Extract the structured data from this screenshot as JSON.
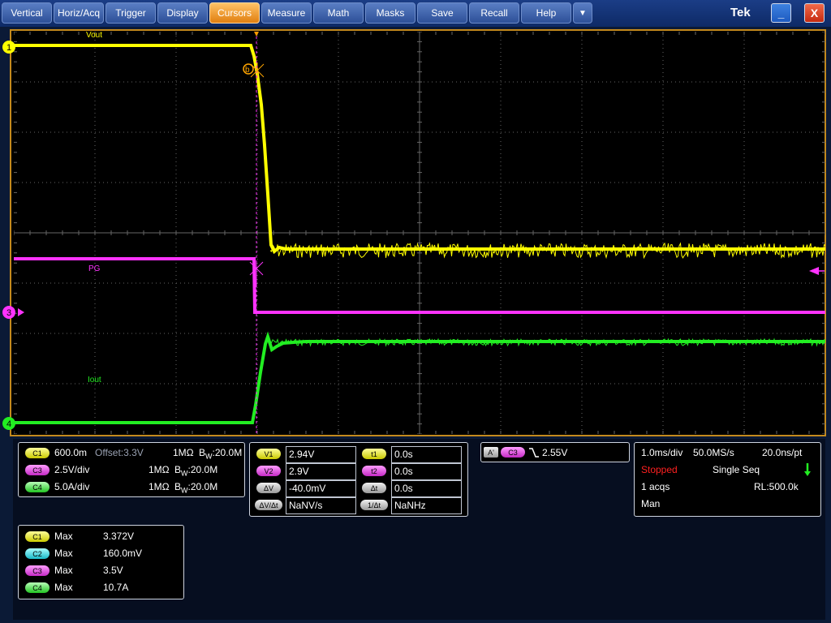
{
  "menu": {
    "items": [
      "Vertical",
      "Horiz/Acq",
      "Trigger",
      "Display",
      "Cursors",
      "Measure",
      "Math",
      "Masks",
      "Save",
      "Recall",
      "Help"
    ],
    "active": "Cursors",
    "more": "▼",
    "brand": "Tek",
    "minimize": "_",
    "close": "X"
  },
  "waveform": {
    "labels": {
      "vout": "Vout",
      "pg": "PG",
      "iout": "Iout"
    },
    "markers": {
      "ch1": "1",
      "ch3": "3",
      "ch4": "4",
      "cursor_b": "b"
    },
    "colors": {
      "ch1": "#ffff00",
      "ch3": "#ff33ff",
      "ch4": "#22ee22",
      "grid": "#666666",
      "frame": "#c48a1d"
    }
  },
  "channels": [
    {
      "tag": "C1",
      "scale": "600.0m",
      "offset": "Offset:3.3V",
      "impedance": "1MΩ",
      "bw_prefix": "B",
      "bw_sub": "W",
      "bw": ":20.0M"
    },
    {
      "tag": "C3",
      "scale": "2.5V/div",
      "offset": "",
      "impedance": "1MΩ",
      "bw_prefix": "B",
      "bw_sub": "W",
      "bw": ":20.0M"
    },
    {
      "tag": "C4",
      "scale": "5.0A/div",
      "offset": "",
      "impedance": "1MΩ",
      "bw_prefix": "B",
      "bw_sub": "W",
      "bw": ":20.0M"
    }
  ],
  "cursors": {
    "v1": {
      "label": "V1",
      "value": "2.94V"
    },
    "v2": {
      "label": "V2",
      "value": "2.9V"
    },
    "dv": {
      "label": "ΔV",
      "value": "-40.0mV"
    },
    "dvdt": {
      "label": "ΔV/Δt",
      "value": "NaNV/s"
    },
    "t1": {
      "label": "t1",
      "value": "0.0s"
    },
    "t2": {
      "label": "t2",
      "value": "0.0s"
    },
    "dt": {
      "label": "Δt",
      "value": "0.0s"
    },
    "inv_dt": {
      "label": "1/Δt",
      "value": "NaNHz"
    }
  },
  "trigger": {
    "mode": "A'",
    "source": "C3",
    "level": "2.55V"
  },
  "acquisition": {
    "time_div": "1.0ms/div",
    "sample_rate": "50.0MS/s",
    "resolution": "20.0ns/pt",
    "status": "Stopped",
    "mode": "Single Seq",
    "acqs": "1 acqs",
    "record_length": "RL:500.0k",
    "trigger_mode": "Man"
  },
  "measurements": [
    {
      "tag": "C1",
      "name": "Max",
      "value": "3.372V"
    },
    {
      "tag": "C2",
      "name": "Max",
      "value": "160.0mV"
    },
    {
      "tag": "C3",
      "name": "Max",
      "value": "3.5V"
    },
    {
      "tag": "C4",
      "name": "Max",
      "value": "10.7A"
    }
  ]
}
